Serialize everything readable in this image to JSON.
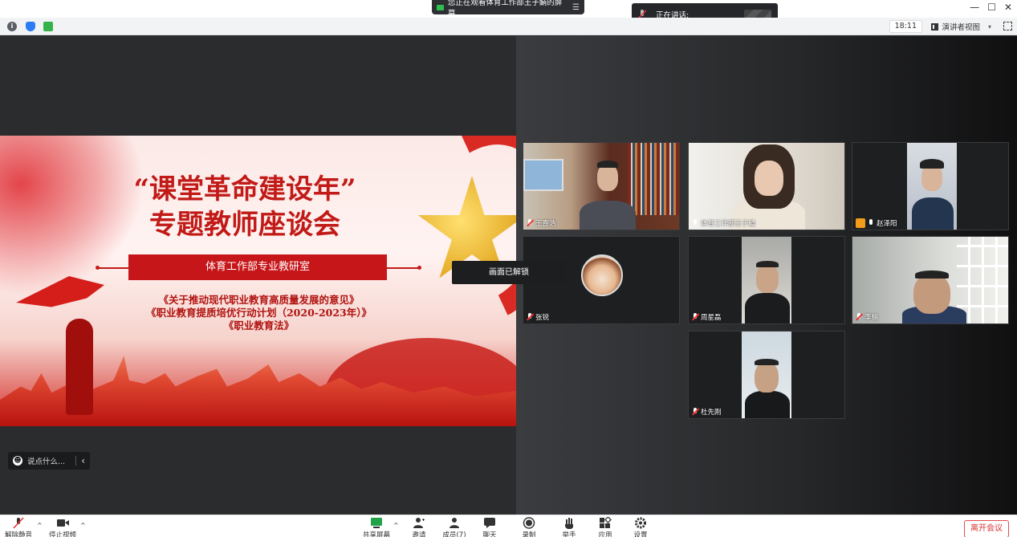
{
  "share_banner": {
    "text": "您正在观看体育工作部王子鲭的屏幕",
    "menu_icon": "menu-icon"
  },
  "speaking": {
    "label": "正在讲话:"
  },
  "window_controls": {
    "minimize": "—",
    "maximize": "☐",
    "close": "✕"
  },
  "toolbar": {
    "info_icon": "i",
    "time": "18:11",
    "view_label": "演讲者视图",
    "view_caret": "▾"
  },
  "slide": {
    "title_line1": "“课堂革命建设年”",
    "title_line2": "专题教师座谈会",
    "band": "体育工作部专业教研室",
    "ref1": "《关于推动现代职业教育高质量发展的意见》",
    "ref2": "《职业教育提质培优行动计划（2020-2023年）》",
    "ref3": "《职业教育法》"
  },
  "lock_toast": "画面已解锁",
  "chat": {
    "placeholder": "说点什么...",
    "collapse": "‹"
  },
  "participants": [
    {
      "name": "王嘉浩",
      "mic": "muted"
    },
    {
      "name": "体育工作部王子鲭",
      "mic": "on"
    },
    {
      "name": "赵泽阳",
      "mic": "on",
      "host": true
    },
    {
      "name": "张锐",
      "mic": "muted"
    },
    {
      "name": "周星磊",
      "mic": "muted"
    },
    {
      "name": "李楠",
      "mic": "muted"
    },
    {
      "name": "杜先刚",
      "mic": "muted"
    }
  ],
  "bottom": {
    "unmute": "解除静音",
    "stop_video": "停止视频",
    "share": "共享屏幕",
    "invite": "邀请",
    "members": "成员(7)",
    "chat": "聊天",
    "record": "录制",
    "raise_hand": "举手",
    "apps": "应用",
    "settings": "设置",
    "leave": "离开会议",
    "caret": "^"
  },
  "colors": {
    "accent_red": "#c11a17",
    "leave_red": "#d93131",
    "share_green": "#2fbf4f"
  }
}
